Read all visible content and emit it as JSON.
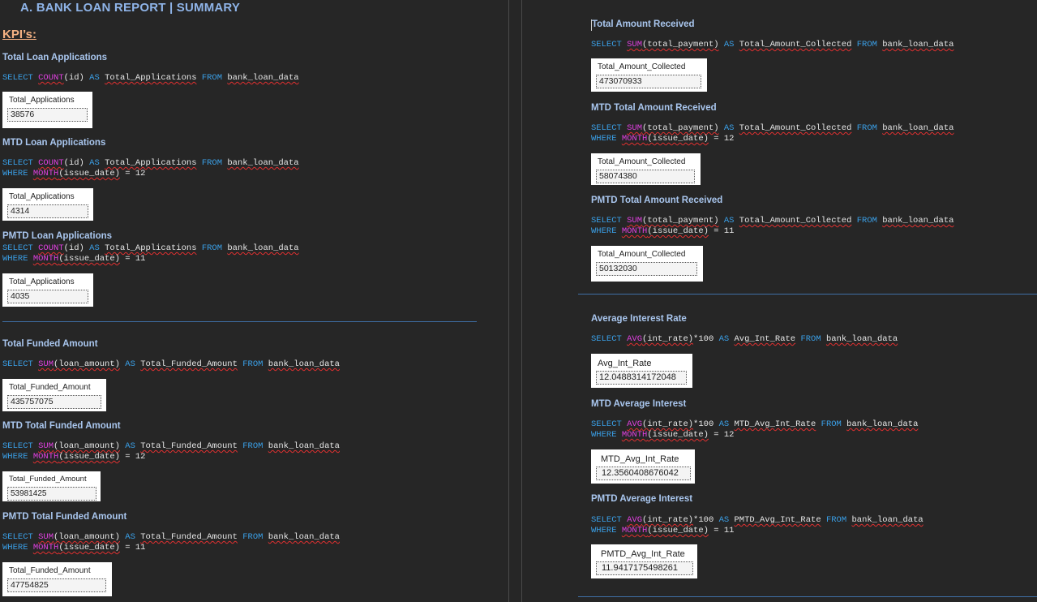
{
  "report_title": "A.  BANK LOAN REPORT | SUMMARY",
  "kpi_heading": "KPI’s:",
  "sql": {
    "select": "SELECT",
    "as": "AS",
    "from": "FROM",
    "where": "WHERE",
    "table": "bank_loan_data",
    "count": "COUNT",
    "sum": "SUM",
    "avg": "AVG",
    "month": "MONTH",
    "col_id": "(id)",
    "col_loan_amount": "(loan_amount)",
    "col_total_payment": "(total_payment)",
    "col_int_rate": "(int_rate)",
    "col_issue_date": "(issue_date)",
    "times_100": "*100",
    "eq_12": " = 12",
    "eq_11": " = 11",
    "alias_total_applications": "Total_Applications",
    "alias_total_funded_amount": "Total_Funded_Amount",
    "alias_total_amount_collected": "Total_Amount_Collected",
    "alias_avg_int_rate": "Avg_Int_Rate",
    "alias_mtd_avg_int_rate": "MTD_Avg_Int_Rate",
    "alias_pmtd_avg_int_rate": "PMTD_Avg_Int_Rate"
  },
  "sections": {
    "total_loan_applications": {
      "title": "Total Loan Applications",
      "result_header": "Total_Applications",
      "result_value": "38576"
    },
    "mtd_loan_applications": {
      "title": "MTD Loan Applications",
      "result_header": "Total_Applications",
      "result_value": "4314"
    },
    "pmtd_loan_applications": {
      "title": "PMTD Loan Applications",
      "result_header": "Total_Applications",
      "result_value": "4035"
    },
    "total_funded_amount": {
      "title": "Total Funded Amount",
      "result_header": "Total_Funded_Amount",
      "result_value": "435757075"
    },
    "mtd_total_funded_amount": {
      "title": "MTD Total Funded Amount",
      "result_header": "Total_Funded_Amount",
      "result_value": "53981425"
    },
    "pmtd_total_funded_amount": {
      "title": "PMTD Total Funded Amount",
      "result_header": "Total_Funded_Amount",
      "result_value": "47754825"
    },
    "total_amount_received": {
      "title": "Total Amount Received",
      "result_header": "Total_Amount_Collected",
      "result_value": "473070933"
    },
    "mtd_total_amount_received": {
      "title": "MTD Total Amount Received",
      "result_header": "Total_Amount_Collected",
      "result_value": "58074380"
    },
    "pmtd_total_amount_received": {
      "title": "PMTD Total Amount Received",
      "result_header": "Total_Amount_Collected",
      "result_value": "50132030"
    },
    "average_interest_rate": {
      "title": "Average Interest Rate",
      "result_header": "Avg_Int_Rate",
      "result_value": "12.0488314172048"
    },
    "mtd_average_interest": {
      "title": "MTD Average Interest",
      "result_header": "MTD_Avg_Int_Rate",
      "result_value": "12.3560408676042"
    },
    "pmtd_average_interest": {
      "title": "PMTD Average Interest",
      "result_header": "PMTD_Avg_Int_Rate",
      "result_value": "11.9417175498261"
    }
  }
}
